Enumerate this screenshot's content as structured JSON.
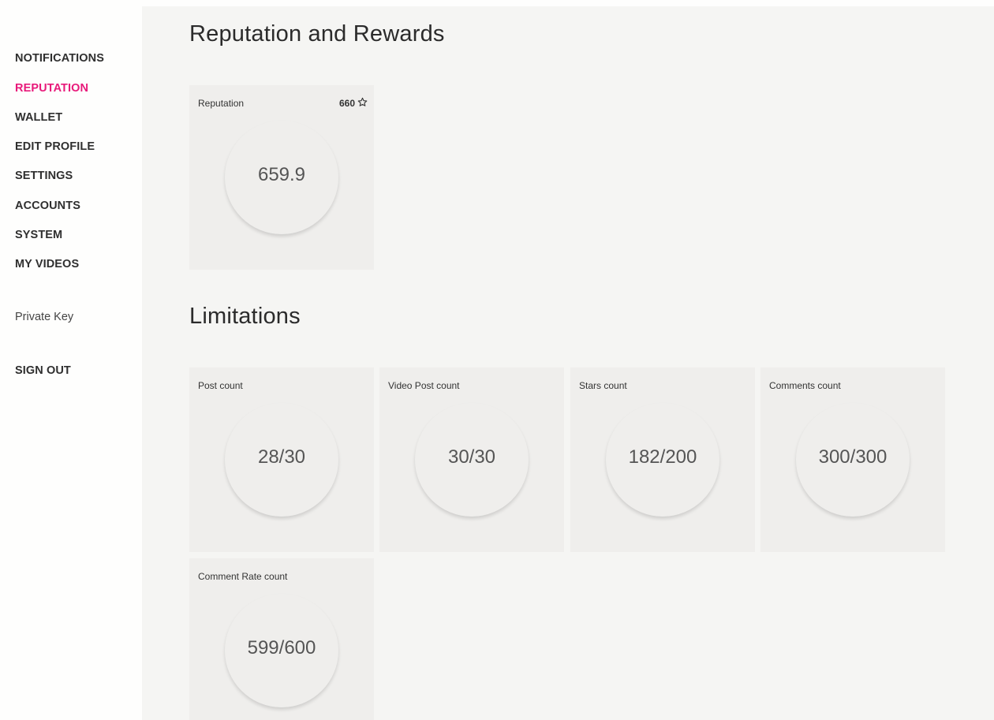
{
  "sidebar": {
    "items": [
      {
        "label": "NOTIFICATIONS"
      },
      {
        "label": "REPUTATION"
      },
      {
        "label": "WALLET"
      },
      {
        "label": "EDIT PROFILE"
      },
      {
        "label": "SETTINGS"
      },
      {
        "label": "ACCOUNTS"
      },
      {
        "label": "SYSTEM"
      },
      {
        "label": "MY VIDEOS"
      }
    ],
    "private_key": "Private Key",
    "sign_out": "SIGN OUT",
    "active_color": "#e8197a"
  },
  "reputation": {
    "title": "Reputation and Rewards",
    "card": {
      "label": "Reputation",
      "badge": "660",
      "badge_icon": "star-icon",
      "value": "659.9"
    }
  },
  "limitations": {
    "title": "Limitations",
    "cards": [
      {
        "label": "Post count",
        "value": "28/30"
      },
      {
        "label": "Video Post count",
        "value": "30/30"
      },
      {
        "label": "Stars count",
        "value": "182/200"
      },
      {
        "label": "Comments count",
        "value": "300/300"
      },
      {
        "label": "Comment Rate count",
        "value": "599/600"
      }
    ]
  }
}
